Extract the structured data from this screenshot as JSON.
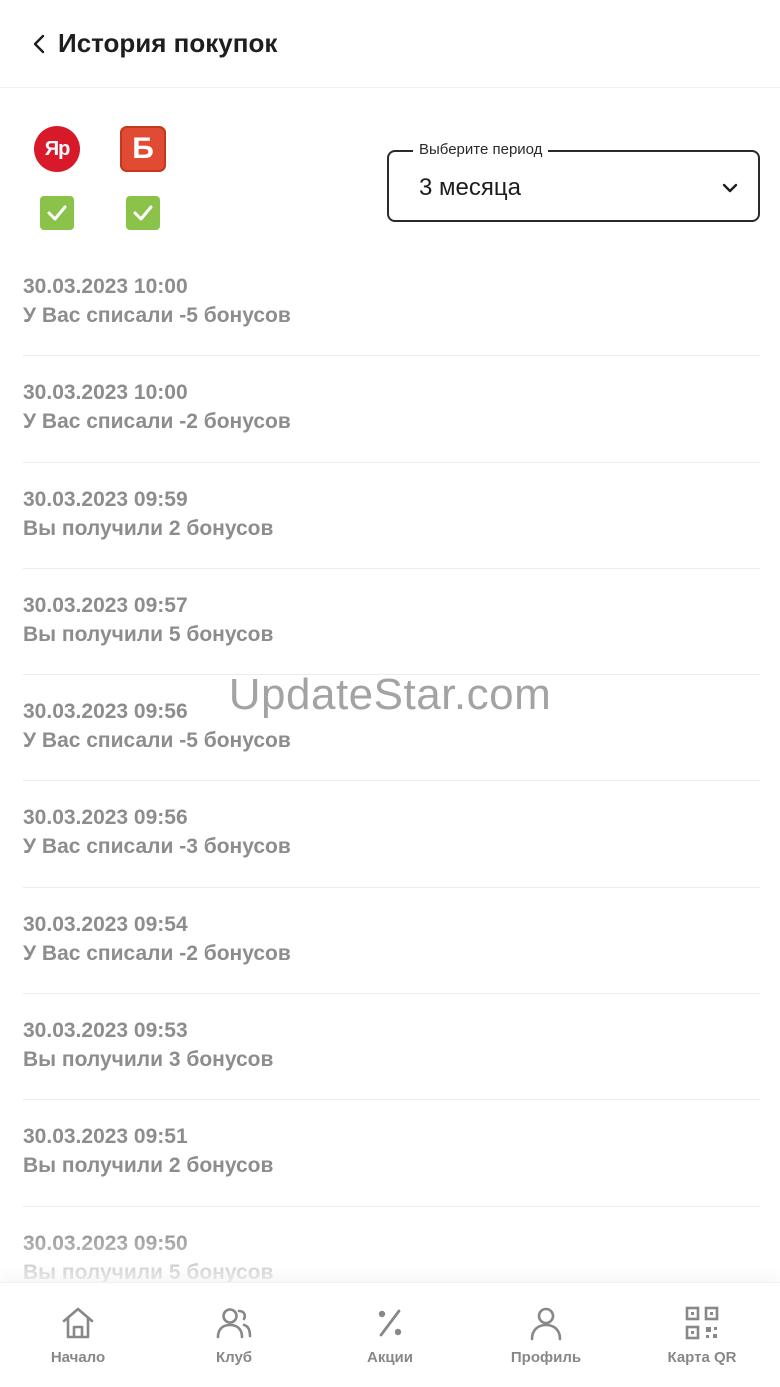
{
  "header": {
    "title": "История покупок",
    "back_icon": "chevron-left-icon"
  },
  "stores": [
    {
      "logo_text": "Яр",
      "color": "#d7192a",
      "checked": true
    },
    {
      "logo_text": "Б",
      "color": "#e24b33",
      "checked": true
    }
  ],
  "period": {
    "label": "Выберите период",
    "value": "3 месяца"
  },
  "history": [
    {
      "date": "30.03.2023 10:00",
      "text": "У Вас списали -5 бонусов"
    },
    {
      "date": "30.03.2023 10:00",
      "text": "У Вас списали -2 бонусов"
    },
    {
      "date": "30.03.2023 09:59",
      "text": "Вы получили 2 бонусов"
    },
    {
      "date": "30.03.2023 09:57",
      "text": "Вы получили 5 бонусов"
    },
    {
      "date": "30.03.2023 09:56",
      "text": "У Вас списали -5 бонусов"
    },
    {
      "date": "30.03.2023 09:56",
      "text": "У Вас списали -3 бонусов"
    },
    {
      "date": "30.03.2023 09:54",
      "text": "У Вас списали -2 бонусов"
    },
    {
      "date": "30.03.2023 09:53",
      "text": "Вы получили 3 бонусов"
    },
    {
      "date": "30.03.2023 09:51",
      "text": "Вы получили 2 бонусов"
    },
    {
      "date": "30.03.2023 09:50",
      "text": "Вы получили 5 бонусов"
    }
  ],
  "watermark": "UpdateStar.com",
  "tabbar": {
    "items": [
      {
        "label": "Начало",
        "icon": "home-icon"
      },
      {
        "label": "Клуб",
        "icon": "users-icon"
      },
      {
        "label": "Акции",
        "icon": "percent-icon"
      },
      {
        "label": "Профиль",
        "icon": "profile-icon"
      },
      {
        "label": "Карта QR",
        "icon": "qr-code-icon"
      }
    ]
  },
  "colors": {
    "check": "#8bc34a",
    "text_muted": "#8d8d8d",
    "accent_red": "#d7192a"
  }
}
